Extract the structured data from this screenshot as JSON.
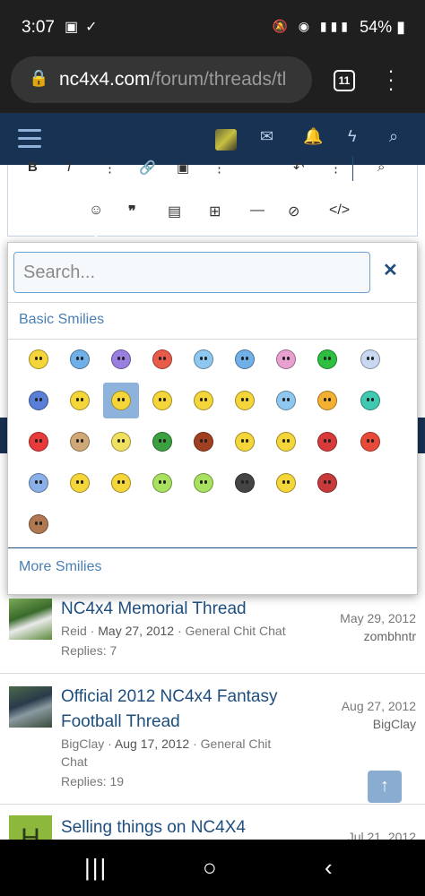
{
  "status": {
    "time": "3:07",
    "battery": "54%"
  },
  "browser": {
    "domain": "nc4x4.com",
    "path": "/forum/threads/tl",
    "tab_count": "11"
  },
  "editor_toolbar": {
    "row1": [
      "B",
      "I",
      "⋮",
      "link",
      "image",
      "⋮",
      "undo",
      "⋮",
      "preview"
    ],
    "row2": [
      "smilie",
      "quote",
      "media",
      "table",
      "hr",
      "spoiler",
      "code"
    ]
  },
  "smilie_popup": {
    "search_placeholder": "Search...",
    "close_label": "✕",
    "category": "Basic Smilies",
    "more_label": "More Smilies",
    "smilies": [
      {
        "color": "#f4d63a"
      },
      {
        "color": "#6fb0e8"
      },
      {
        "color": "#9a7fe0"
      },
      {
        "color": "#e85a4a"
      },
      {
        "color": "#8ec8f0"
      },
      {
        "color": "#6fb0e8"
      },
      {
        "color": "#e8a0d0"
      },
      {
        "color": "#2fbf40"
      },
      {
        "color": "#c8d8f0"
      },
      {
        "color": "#5a7fd8"
      },
      {
        "color": "#f4d63a"
      },
      {
        "color": "#f4d63a"
      },
      {
        "color": "#f4d63a"
      },
      {
        "color": "#f4d63a"
      },
      {
        "color": "#f4d63a"
      },
      {
        "color": "#8ec8f0"
      },
      {
        "color": "#f4b030"
      },
      {
        "color": "#40c8b0"
      },
      {
        "color": "#e83a3a"
      },
      {
        "color": "#d0a878"
      },
      {
        "color": "#f0e060"
      },
      {
        "color": "#3aa040"
      },
      {
        "color": "#a04020"
      },
      {
        "color": "#f4d63a"
      },
      {
        "color": "#f4d63a"
      },
      {
        "color": "#d83a3a"
      },
      {
        "color": "#e84a3a"
      },
      {
        "color": "#8ab0e8"
      },
      {
        "color": "#f4d63a"
      },
      {
        "color": "#f4d63a"
      },
      {
        "color": "#a8e060"
      },
      {
        "color": "#a8e060"
      },
      {
        "color": "#444444"
      },
      {
        "color": "#f4d63a"
      },
      {
        "color": "#c83a3a"
      },
      {
        "color": "#b07850"
      }
    ]
  },
  "threads": [
    {
      "title": "NC4x4 Memorial Thread",
      "poster": "Reid",
      "start_date": "May 27, 2012",
      "forum": "General Chit Chat",
      "replies": "Replies: 7",
      "last_date": "May 29, 2012",
      "last_user": "zombhntr"
    },
    {
      "title": "Official 2012 NC4x4 Fantasy Football Thread",
      "poster": "BigClay",
      "start_date": "Aug 17, 2012",
      "forum": "General Chit Chat",
      "replies": "Replies: 19",
      "last_date": "Aug 27, 2012",
      "last_user": "BigClay"
    },
    {
      "title": "Selling things on NC4X4",
      "avatar_letter": "H",
      "last_date": "Jul 21, 2012"
    }
  ]
}
